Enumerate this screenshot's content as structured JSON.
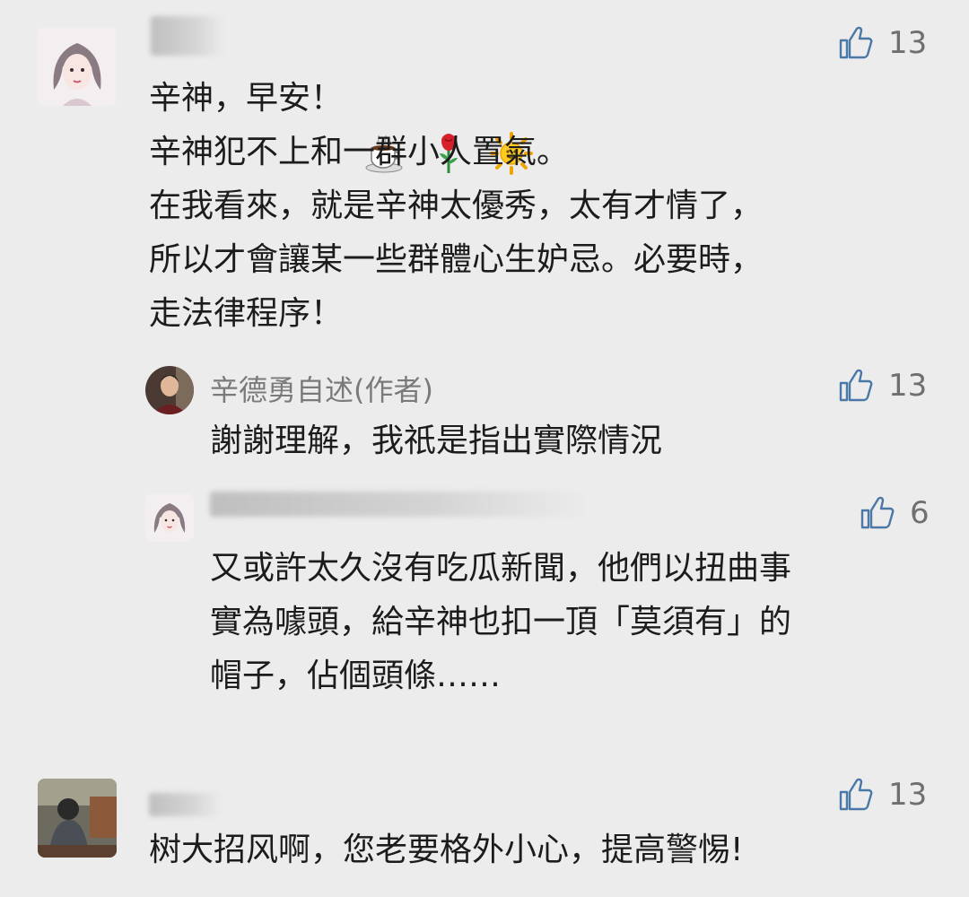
{
  "comments": [
    {
      "likes": "13",
      "line1": "辛神，早安！",
      "rest": "辛神犯不上和一群小人置氣。\n在我看來，就是辛神太優秀，太有才情了，\n所以才會讓某一些群體心生妒忌。必要時，\n走法律程序！",
      "emoji": [
        "coffee-icon",
        "rose-icon",
        "sun-icon"
      ]
    },
    {
      "author": "辛德勇自述(作者)",
      "likes": "13",
      "text": "謝謝理解，我祇是指出實際情況"
    },
    {
      "likes": "6",
      "text": "又或許太久沒有吃瓜新聞，他們以扭曲事\n實為噱頭，給辛神也扣一頂「莫須有」的\n帽子，佔個頭條……"
    },
    {
      "likes": "13",
      "text": "树大招风啊，您老要格外小心，提高警惕!"
    }
  ]
}
